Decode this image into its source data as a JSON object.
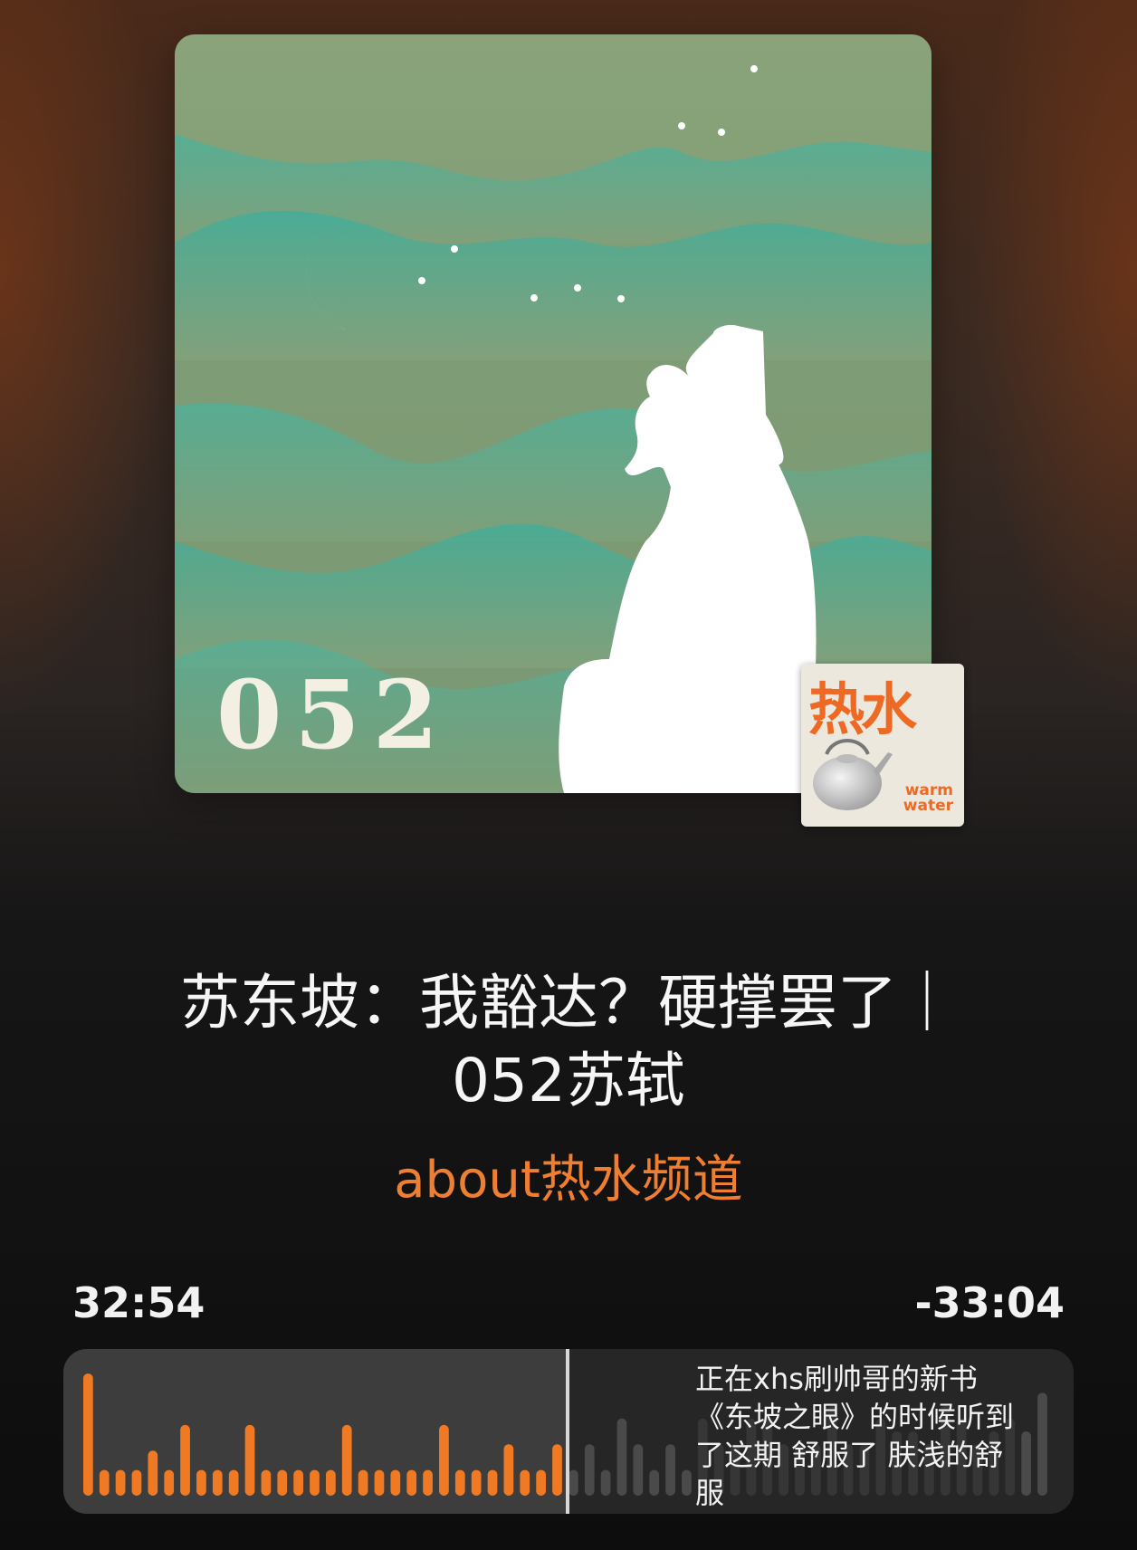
{
  "cover": {
    "episode_number": "052",
    "badge_title": "热水",
    "badge_subtitle_line1": "warm",
    "badge_subtitle_line2": "water"
  },
  "episode": {
    "title": "苏东坡：我豁达？硬撑罢了｜052苏轼",
    "channel": "about热水频道"
  },
  "playback": {
    "elapsed": "32:54",
    "remaining": "-33:04",
    "progress": 0.499
  },
  "comment": {
    "text": "正在xhs刷帅哥的新书《东坡之眼》的时候听到了这期 舒服了 肤浅的舒服"
  },
  "waveform": {
    "bars": [
      0.95,
      0.2,
      0.2,
      0.2,
      0.35,
      0.2,
      0.55,
      0.2,
      0.2,
      0.2,
      0.55,
      0.2,
      0.2,
      0.2,
      0.2,
      0.2,
      0.55,
      0.2,
      0.2,
      0.2,
      0.2,
      0.2,
      0.55,
      0.2,
      0.2,
      0.2,
      0.4,
      0.2,
      0.2,
      0.4,
      0.2,
      0.4,
      0.2,
      0.6,
      0.4,
      0.2,
      0.4,
      0.2,
      0.6,
      0.4,
      0.4,
      0.6,
      0.6,
      0.4,
      0.4,
      0.4,
      0.7,
      0.4,
      0.4,
      0.6,
      0.5,
      0.5,
      0.4,
      0.7,
      0.6,
      0.4,
      0.5,
      0.6,
      0.5,
      0.8
    ],
    "played_color": "#f07a24",
    "unplayed_color": "#4a4a4a"
  },
  "colors": {
    "accent": "#ee7f32"
  }
}
